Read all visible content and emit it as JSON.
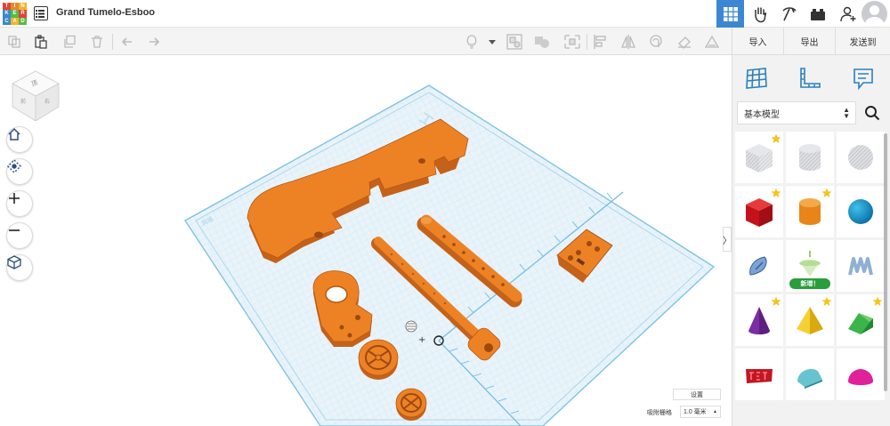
{
  "app": {
    "logo_letters": [
      "T",
      "I",
      "N",
      "K",
      "E",
      "R",
      "C",
      "A",
      "D"
    ],
    "logo_colors": [
      "#e2442f",
      "#e58a30",
      "#f0b429",
      "#3a88c9",
      "#59b947",
      "#e2442f",
      "#3a88c9",
      "#f0b429",
      "#59b947"
    ],
    "design_title": "Grand Tumelo-Esboo"
  },
  "header": {
    "icons": [
      "grid-view-icon",
      "gallery-hand-icon",
      "pickaxe-icon",
      "lego-bricks-icon",
      "add-user-icon",
      "avatar"
    ],
    "active_color": "#3b87d1"
  },
  "toolbar": {
    "left_icons": [
      "copy-icon",
      "paste-icon",
      "duplicate-icon",
      "delete-icon",
      "undo-icon",
      "redo-icon"
    ],
    "right_icons": [
      "light-bulb-icon",
      "dropdown-caret-icon",
      "group-icon",
      "ungroup-icon",
      "workplane-icon",
      "align-icon",
      "mirror-icon",
      "cruise-icon",
      "paint-icon",
      "ruler-icon"
    ],
    "import_label": "导入",
    "export_label": "导出",
    "send_label": "发送到"
  },
  "viewport": {
    "view_cube_label": "视图方块",
    "nav": [
      "home-view-button",
      "fit-view-button",
      "zoom-in-button",
      "zoom-out-button",
      "perspective-button"
    ],
    "settings_label": "设置",
    "snap_label": "吸附栅格",
    "snap_value": "1.0 毫米",
    "workplane_title": "工作平面",
    "grid_color": "#bde0f1",
    "model_color": "#ea7c1f"
  },
  "panel": {
    "tabs": [
      "workplane-tool-icon",
      "ruler-tool-icon",
      "notes-tool-icon"
    ],
    "category": "基本模型",
    "new_badge": "新增！",
    "shapes": [
      {
        "name": "box-hole",
        "starred": true
      },
      {
        "name": "cylinder-hole",
        "starred": false
      },
      {
        "name": "sphere-hole",
        "starred": false
      },
      {
        "name": "box",
        "starred": true
      },
      {
        "name": "cylinder",
        "starred": true
      },
      {
        "name": "sphere",
        "starred": false
      },
      {
        "name": "scribble",
        "starred": false
      },
      {
        "name": "shape-generator",
        "starred": false
      },
      {
        "name": "text-3d",
        "starred": false
      },
      {
        "name": "cone",
        "starred": true
      },
      {
        "name": "pyramid",
        "starred": true
      },
      {
        "name": "roof",
        "starred": true
      },
      {
        "name": "text",
        "starred": false
      },
      {
        "name": "half-cylinder",
        "starred": false
      },
      {
        "name": "half-sphere",
        "starred": false
      }
    ]
  }
}
